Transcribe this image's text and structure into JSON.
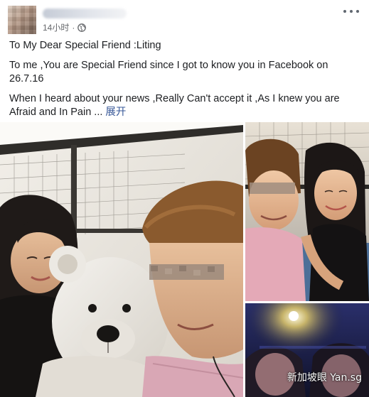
{
  "post": {
    "timestamp": "14小时",
    "privacy_icon": "globe-icon",
    "menu_icon": "more-options-icon",
    "lines": [
      "To My Dear Special Friend :Liting",
      "To me ,You are Special Friend since I got to know you in Facebook on 26.7.16",
      "When I heard about your news ,Really Can't accept it ,As I knew you are Afraid and In Pain ..."
    ],
    "see_more": "展开"
  },
  "photos": {
    "watermark": "新加坡眼 Yan.sg"
  },
  "colors": {
    "link": "#385898",
    "meta_text": "#65676b",
    "body_text": "#1c1e21"
  }
}
